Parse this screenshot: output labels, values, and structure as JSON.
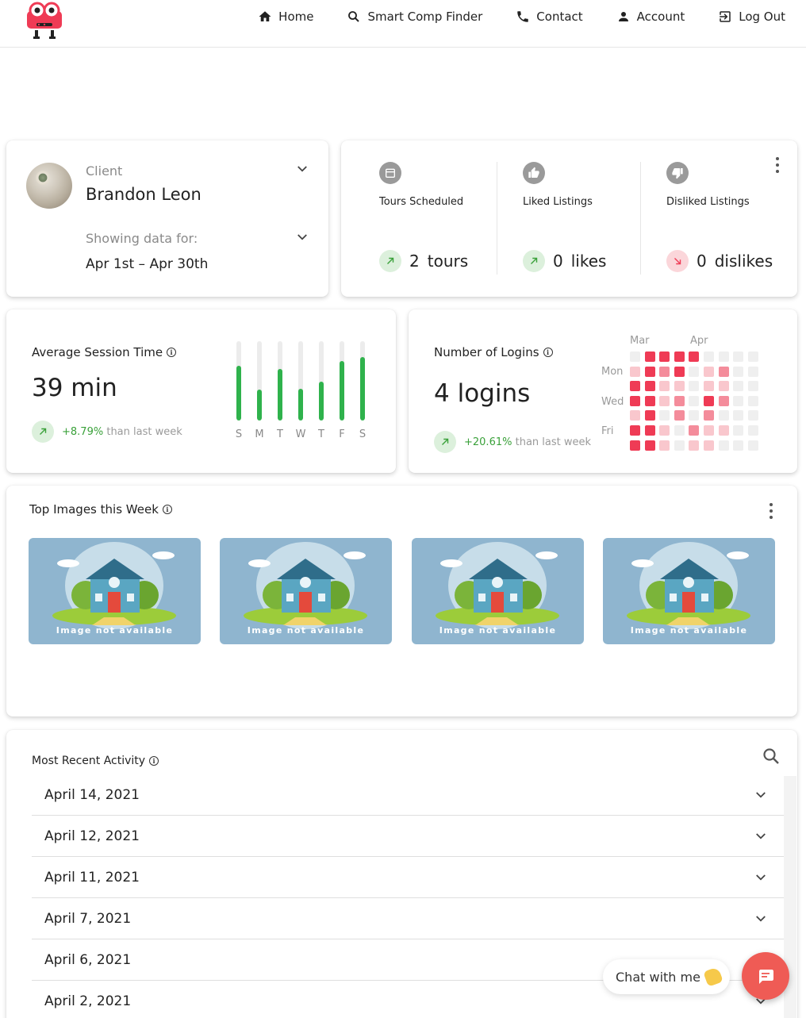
{
  "nav": {
    "items": [
      {
        "label": "Home",
        "icon": "home-icon"
      },
      {
        "label": "Smart Comp Finder",
        "icon": "search-icon"
      },
      {
        "label": "Contact",
        "icon": "phone-icon"
      },
      {
        "label": "Account",
        "icon": "person-icon"
      },
      {
        "label": "Log Out",
        "icon": "logout-icon"
      }
    ]
  },
  "client": {
    "role_label": "Client",
    "name": "Brandon Leon",
    "showing_label": "Showing data for:",
    "date_range": "Apr 1st – Apr 30th"
  },
  "stats": [
    {
      "label": "Tours Scheduled",
      "icon": "calendar-icon",
      "value": "2",
      "unit": "tours",
      "trend": "up"
    },
    {
      "label": "Liked Listings",
      "icon": "thumbs-up-icon",
      "value": "0",
      "unit": "likes",
      "trend": "up"
    },
    {
      "label": "Disliked Listings",
      "icon": "thumbs-down-icon",
      "value": "0",
      "unit": "dislikes",
      "trend": "down"
    }
  ],
  "session": {
    "title": "Average Session Time",
    "value": "39 min",
    "delta": "+8.79%",
    "delta_suffix": "than last week",
    "days": [
      "S",
      "M",
      "T",
      "W",
      "T",
      "F",
      "S"
    ],
    "levels": [
      0.69,
      0.39,
      0.65,
      0.4,
      0.49,
      0.75,
      0.8
    ]
  },
  "logins": {
    "title": "Number of Logins",
    "value": "4 logins",
    "delta": "+20.61%",
    "delta_suffix": "than last week",
    "months": [
      "Mar",
      "Apr"
    ],
    "days": [
      "Mon",
      "Wed",
      "Fri"
    ],
    "grid": [
      [
        0,
        3,
        3,
        3,
        3,
        0,
        0,
        0,
        0
      ],
      [
        1,
        3,
        2,
        3,
        0,
        1,
        2,
        0,
        0
      ],
      [
        3,
        3,
        1,
        1,
        0,
        1,
        1,
        0,
        0
      ],
      [
        3,
        3,
        1,
        2,
        0,
        3,
        2,
        0,
        0
      ],
      [
        1,
        3,
        0,
        2,
        0,
        2,
        0,
        0,
        0
      ],
      [
        3,
        3,
        1,
        0,
        2,
        1,
        1,
        0,
        0
      ],
      [
        3,
        3,
        1,
        0,
        1,
        1,
        0,
        0,
        0
      ]
    ],
    "colors": [
      "#efefef",
      "#f9c7cd",
      "#f48c9b",
      "#ef3b55"
    ]
  },
  "top_images": {
    "title": "Top Images this Week",
    "tiles": [
      {
        "caption": "Image not available"
      },
      {
        "caption": "Image not available"
      },
      {
        "caption": "Image not available"
      },
      {
        "caption": "Image not available"
      }
    ]
  },
  "activity": {
    "title": "Most Recent Activity",
    "rows": [
      "April 14, 2021",
      "April 12, 2021",
      "April 11, 2021",
      "April 7, 2021",
      "April 6, 2021",
      "April 2, 2021"
    ]
  },
  "chat": {
    "label": "Chat with me"
  }
}
